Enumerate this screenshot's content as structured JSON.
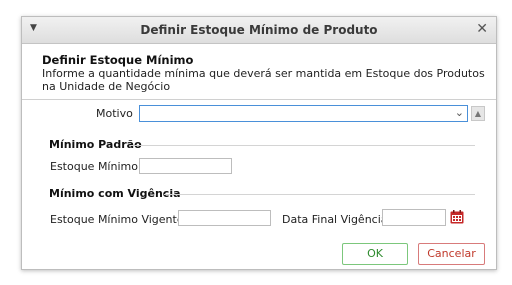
{
  "window": {
    "title": "Definir Estoque Mínimo de Produto"
  },
  "header": {
    "title": "Definir Estoque Mínimo",
    "description": "Informe a quantidade mínima que deverá ser mantida em Estoque dos Produtos na Unidade de Negócio"
  },
  "motivo": {
    "label": "Motivo",
    "value": ""
  },
  "minimo_padrao": {
    "section_title": "Mínimo Padrão",
    "estoque_minimo_label": "Estoque Mínimo",
    "estoque_minimo_value": ""
  },
  "minimo_vigencia": {
    "section_title": "Mínimo com Vigência",
    "estoque_minimo_vigente_label": "Estoque Mínimo Vigente",
    "estoque_minimo_vigente_value": "",
    "data_final_label": "Data Final Vigência",
    "data_final_value": ""
  },
  "buttons": {
    "ok_label": "OK",
    "cancel_label": "Cancelar"
  },
  "icons": {
    "menu": "menu-arrow-icon",
    "close": "close-icon",
    "dropdown": "chevron-down-icon",
    "side": "triangle-up-icon",
    "calendar": "calendar-icon"
  },
  "colors": {
    "ok_border": "#7cc77c",
    "cancel_border": "#d87b7b",
    "calendar": "#c62828",
    "focus_border": "#4a90d9"
  }
}
